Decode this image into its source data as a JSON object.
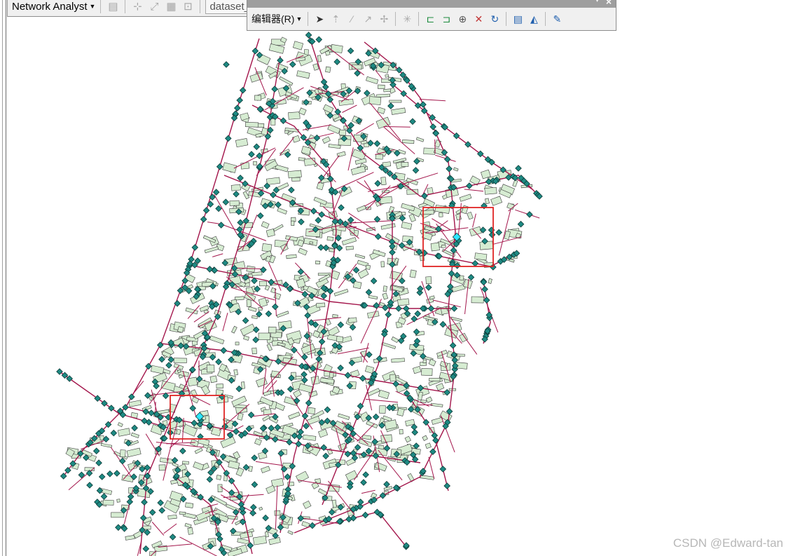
{
  "network_toolbar": {
    "title": "Network Analyst",
    "dataset": "dataset_ND",
    "icons": [
      "network-analyst-window-icon",
      "new-route-icon",
      "solve-icon",
      "directions-icon",
      "build-network-icon"
    ]
  },
  "editor_toolbar": {
    "menu_label": "编辑器(R)",
    "icons": [
      "edit-tool-icon",
      "sketch-tool-icon",
      "straight-segment-icon",
      "trace-icon",
      "midpoint-icon",
      "topology-icon",
      "snapping-icon",
      "edit-vertices-icon",
      "reshape-icon",
      "split-icon",
      "rotate-icon",
      "attributes-icon",
      "sketch-properties-icon",
      "create-features-icon"
    ]
  },
  "map": {
    "road_color": "#a3154b",
    "node_color": "#1e8a83",
    "building_fill": "#d6ecd2",
    "building_stroke": "#3d3d3d",
    "highlight_color": "#e02424",
    "selected_node_color": "#2ee6ff"
  },
  "watermark": "CSDN @Edward-tan"
}
